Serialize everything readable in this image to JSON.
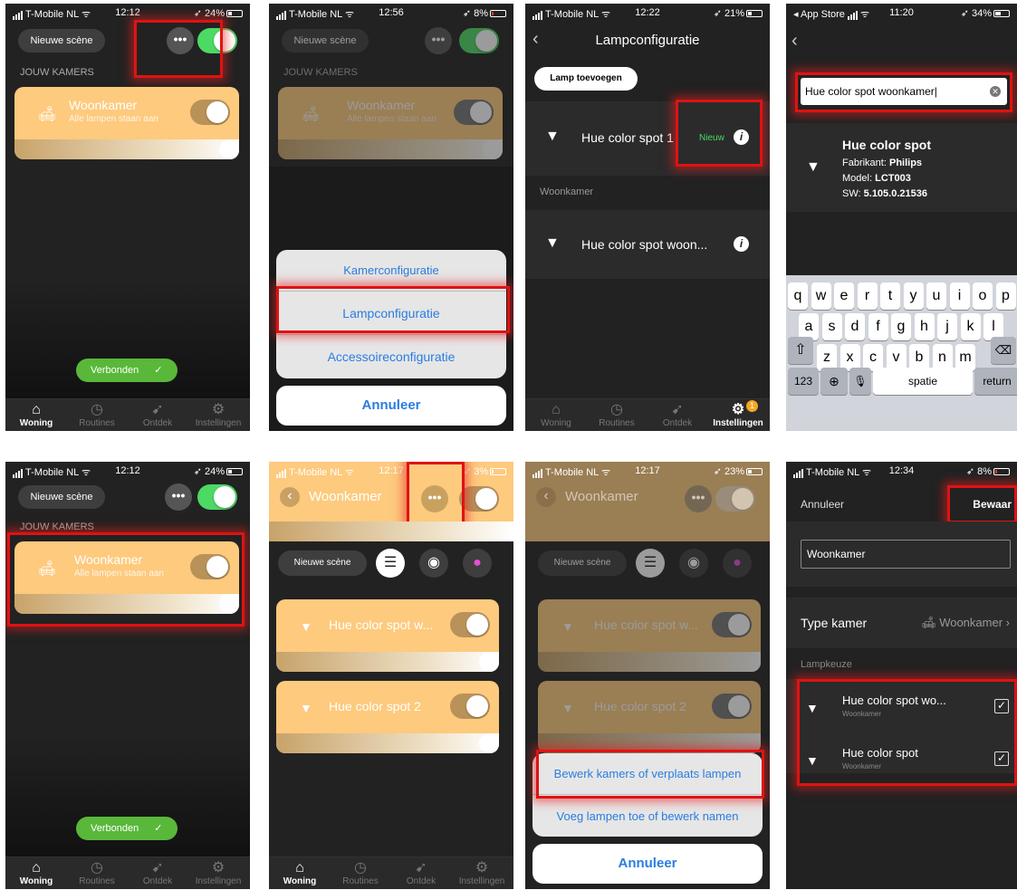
{
  "status": {
    "carrier": "T-Mobile NL",
    "appstore": "App Store",
    "t1": "12:12",
    "t2": "12:56",
    "t3": "12:22",
    "t4": "11:20",
    "t5": "12:12",
    "t6": "12:17",
    "t7": "12:17",
    "t8": "12:34",
    "b1": "24%",
    "b2": "8%",
    "b3": "21%",
    "b4": "34%",
    "b5": "24%",
    "b6": "3%",
    "b7": "23%",
    "b8": "8%"
  },
  "home": {
    "new_scene": "Nieuwe scène",
    "section": "JOUW KAMERS",
    "room": "Woonkamer",
    "room_sub": "Alle lampen staan aan",
    "connected": "Verbonden",
    "check": "✓"
  },
  "tabs": {
    "woning": "Woning",
    "routines": "Routines",
    "ontdek": "Ontdek",
    "instellingen": "Instellingen",
    "badge": "1"
  },
  "sheet1": {
    "item1": "Kamerconfiguratie",
    "item2": "Lampconfiguratie",
    "item3": "Accessoireconfiguratie",
    "cancel": "Annuleer"
  },
  "lampconfig": {
    "title": "Lampconfiguratie",
    "add": "Lamp toevoegen",
    "lamp1": "Hue color spot 1",
    "new": "Nieuw",
    "section": "Woonkamer",
    "lamp2": "Hue color spot woon..."
  },
  "search": {
    "query": "Hue color spot woonkamer",
    "name": "Hue color spot",
    "manufacturer_label": "Fabrikant:",
    "manufacturer": "Philips",
    "model_label": "Model:",
    "model": "LCT003",
    "sw_label": "SW:",
    "sw": "5.105.0.21536",
    "row1": [
      "q",
      "w",
      "e",
      "r",
      "t",
      "y",
      "u",
      "i",
      "o",
      "p"
    ],
    "row2": [
      "a",
      "s",
      "d",
      "f",
      "g",
      "h",
      "j",
      "k",
      "l"
    ],
    "row3": [
      "z",
      "x",
      "c",
      "v",
      "b",
      "n",
      "m"
    ],
    "k123": "123",
    "space": "spatie",
    "return": "return"
  },
  "room": {
    "title": "Woonkamer",
    "new_scene": "Nieuwe scène",
    "lamp1": "Hue color spot w...",
    "lamp2": "Hue color spot 2"
  },
  "sheet2": {
    "item1": "Bewerk kamers of verplaats lampen",
    "item2": "Voeg lampen toe of bewerk namen",
    "cancel": "Annuleer"
  },
  "edit": {
    "cancel": "Annuleer",
    "save": "Bewaar",
    "name": "Woonkamer",
    "type_label": "Type kamer",
    "type_value": "Woonkamer",
    "section": "Lampkeuze",
    "lamp1": "Hue color spot wo...",
    "lamp1_sub": "Woonkamer",
    "lamp2": "Hue color spot",
    "lamp2_sub": "Woonkamer"
  },
  "colors": {
    "accent": "#fdca7e",
    "green": "#4cd964",
    "highlight": "#e01212",
    "link": "#2a7de1"
  }
}
